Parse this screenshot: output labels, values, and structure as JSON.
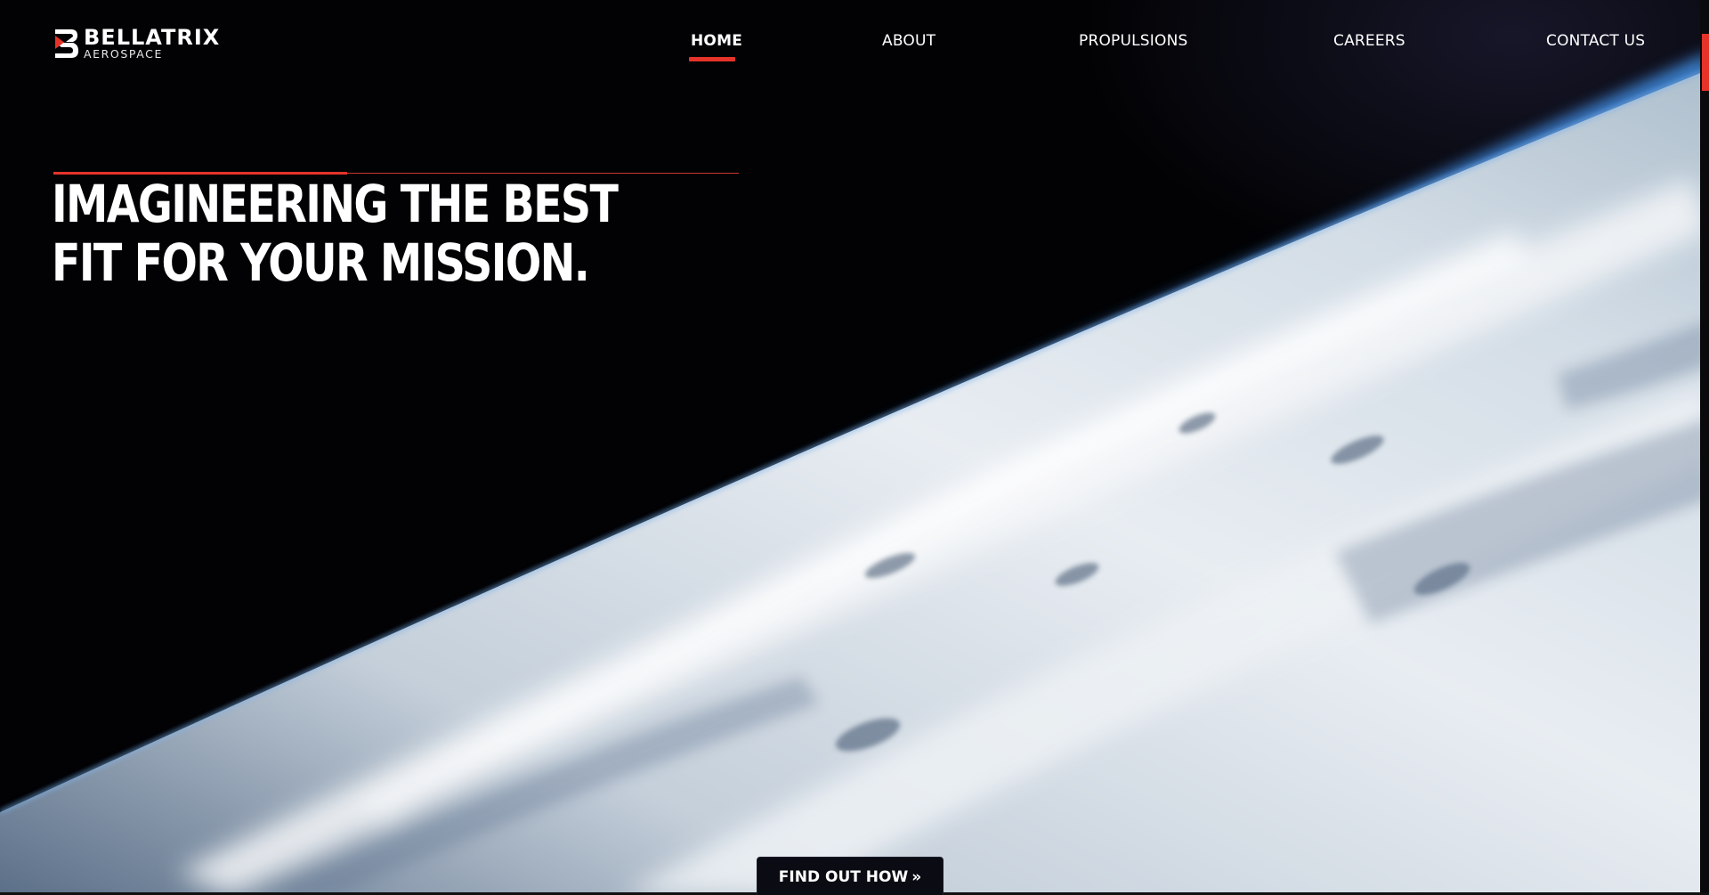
{
  "brand": {
    "name": "BELLATRIX",
    "subtitle": "AEROSPACE"
  },
  "nav": {
    "items": [
      {
        "label": "HOME",
        "active": true
      },
      {
        "label": "ABOUT",
        "active": false
      },
      {
        "label": "PROPULSIONS",
        "active": false
      },
      {
        "label": "CAREERS",
        "active": false
      },
      {
        "label": "CONTACT US",
        "active": false
      }
    ]
  },
  "hero": {
    "headline": "IMAGINEERING THE BEST FIT FOR YOUR MISSION.",
    "cta_label": "FIND OUT HOW",
    "cta_icon": "double-chevron-right-icon"
  },
  "colors": {
    "accent": "#e5332a",
    "background": "#000000",
    "text": "#ffffff",
    "cta_background": "#0b0b14"
  }
}
